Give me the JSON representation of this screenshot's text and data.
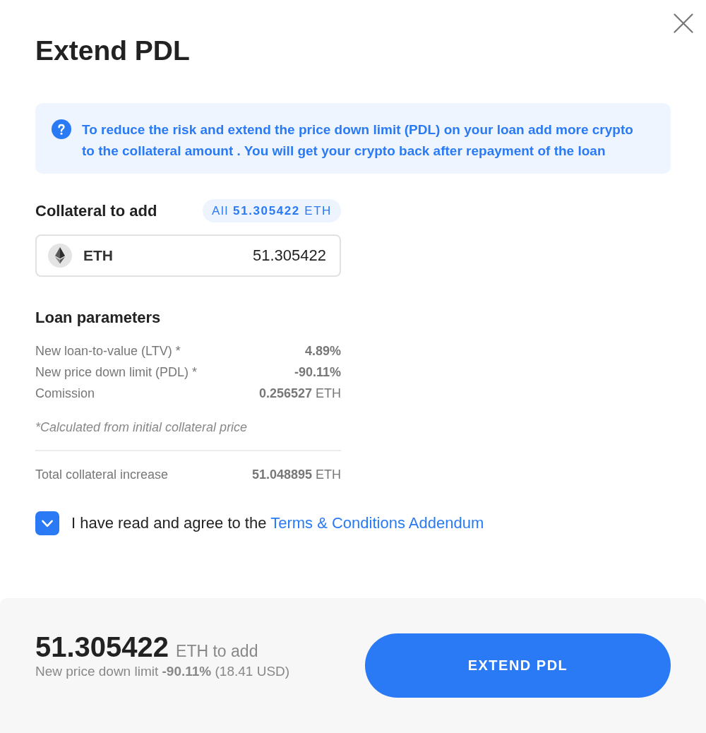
{
  "dialog": {
    "title": "Extend PDL"
  },
  "info": {
    "text": "To reduce the risk and extend the price down limit (PDL) on your loan add more crypto to the collateral amount . You will get your crypto back after repayment of the loan"
  },
  "collateral": {
    "heading": "Collateral to add",
    "all_button": {
      "label": "All",
      "amount": "51.305422",
      "unit": "ETH"
    },
    "input": {
      "currency": "ETH",
      "value": "51.305422"
    }
  },
  "loan_parameters": {
    "heading": "Loan parameters",
    "rows": [
      {
        "label": "New loan-to-value (LTV) *",
        "value": "4.89%"
      },
      {
        "label": "New price down limit (PDL) *",
        "value": "-90.11%"
      },
      {
        "label": "Comission",
        "value": "0.256527",
        "unit": "ETH"
      }
    ],
    "note": "*Calculated from initial collateral price",
    "total": {
      "label": "Total collateral increase",
      "value": "51.048895",
      "unit": "ETH"
    }
  },
  "agreement": {
    "checked": true,
    "text": "I have read and agree to the",
    "link": "Terms & Conditions Addendum"
  },
  "footer": {
    "amount": "51.305422",
    "amount_caption": "ETH to add",
    "summary": "New price down limit **-90.11%** (18.41 USD)",
    "button": "EXTEND PDL"
  }
}
